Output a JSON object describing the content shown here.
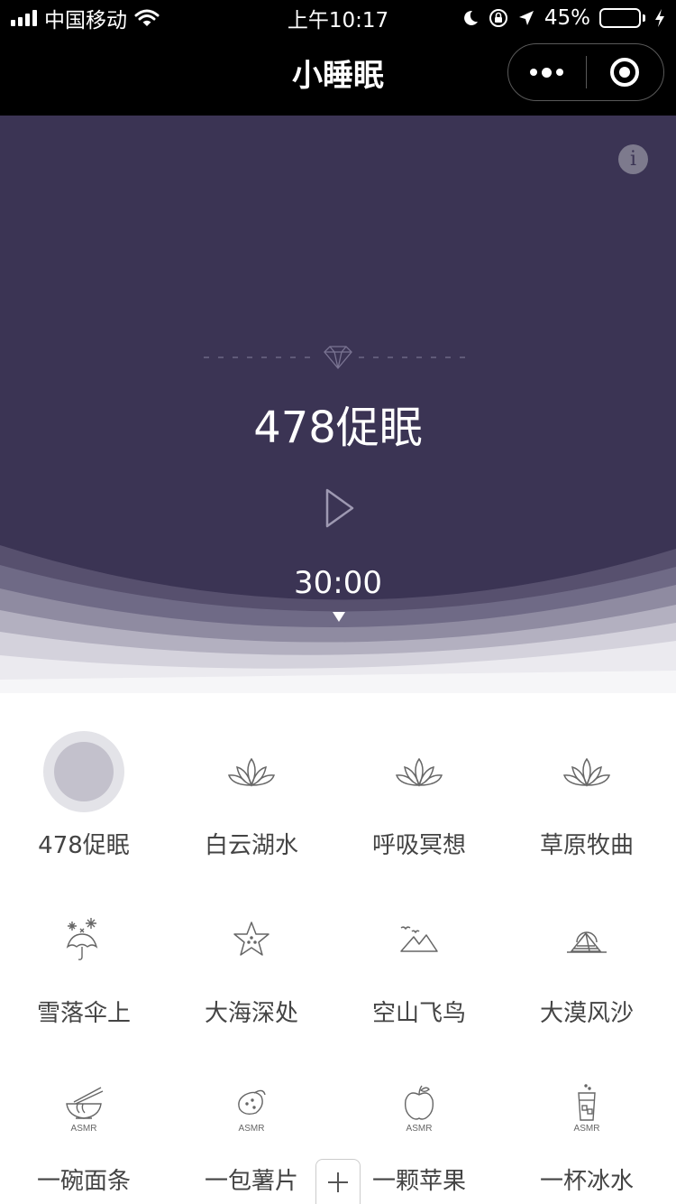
{
  "status_bar": {
    "carrier": "中国移动",
    "time": "上午10:17",
    "battery_percent": "45%",
    "battery_level": 0.45,
    "icons": [
      "signal-icon",
      "wifi-icon",
      "moon-icon",
      "rotation-lock-icon",
      "location-arrow-icon",
      "battery-icon",
      "charging-bolt-icon"
    ]
  },
  "nav": {
    "title": "小睡眠",
    "capsule": [
      "more-dots-icon",
      "close-target-icon"
    ]
  },
  "player": {
    "track_title": "478促眠",
    "timer": "30:00",
    "icons": [
      "info-icon",
      "diamond-icon",
      "play-icon",
      "caret-down-icon"
    ]
  },
  "items": [
    {
      "label": "478促眠",
      "icon": "selected-circle-icon",
      "selected": true
    },
    {
      "label": "白云湖水",
      "icon": "lotus-icon"
    },
    {
      "label": "呼吸冥想",
      "icon": "lotus-icon"
    },
    {
      "label": "草原牧曲",
      "icon": "lotus-icon"
    },
    {
      "label": "雪落伞上",
      "icon": "umbrella-snow-icon"
    },
    {
      "label": "大海深处",
      "icon": "starfish-icon"
    },
    {
      "label": "空山飞鸟",
      "icon": "mountain-birds-icon"
    },
    {
      "label": "大漠风沙",
      "icon": "desert-pyramid-icon"
    },
    {
      "label": "一碗面条",
      "icon": "noodle-bowl-icon",
      "badge": "ASMR"
    },
    {
      "label": "一包薯片",
      "icon": "chips-icon",
      "badge": "ASMR"
    },
    {
      "label": "一颗苹果",
      "icon": "apple-icon",
      "badge": "ASMR"
    },
    {
      "label": "一杯冰水",
      "icon": "ice-water-icon",
      "badge": "ASMR"
    }
  ],
  "add_button": {
    "icon": "plus-icon"
  },
  "colors": {
    "hero_bg": "#3b3454",
    "topbar_bg": "#000000",
    "battery_green": "#4cd964",
    "label_text": "#444444",
    "icon_stroke": "#666666"
  }
}
